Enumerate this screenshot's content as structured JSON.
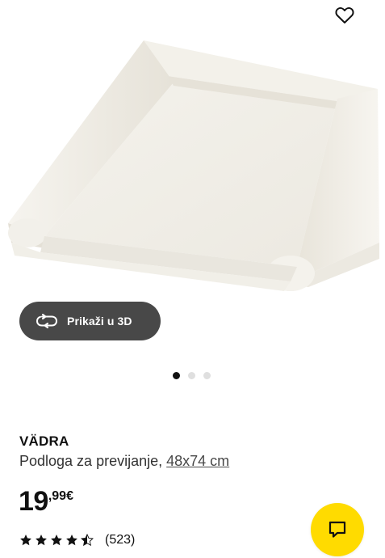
{
  "product": {
    "name": "VÄDRA",
    "description": "Podloga za previjanje,",
    "dimensions": "48x74 cm",
    "image_alt": "changing-pad"
  },
  "price": {
    "integer": "19",
    "decimals": ",99€"
  },
  "rating": {
    "value": 4.5,
    "max": 5,
    "count_label": "(523)"
  },
  "view3d": {
    "label": "Prikaži u 3D",
    "icon": "rotate-3d-icon"
  },
  "carousel": {
    "total": 3,
    "active_index": 0
  },
  "icons": {
    "favourite": "heart-icon",
    "chat": "chat-icon"
  },
  "colors": {
    "chat_button": "#ffdb00",
    "view3d_button": "#484848",
    "product": "#f6f4ee"
  }
}
